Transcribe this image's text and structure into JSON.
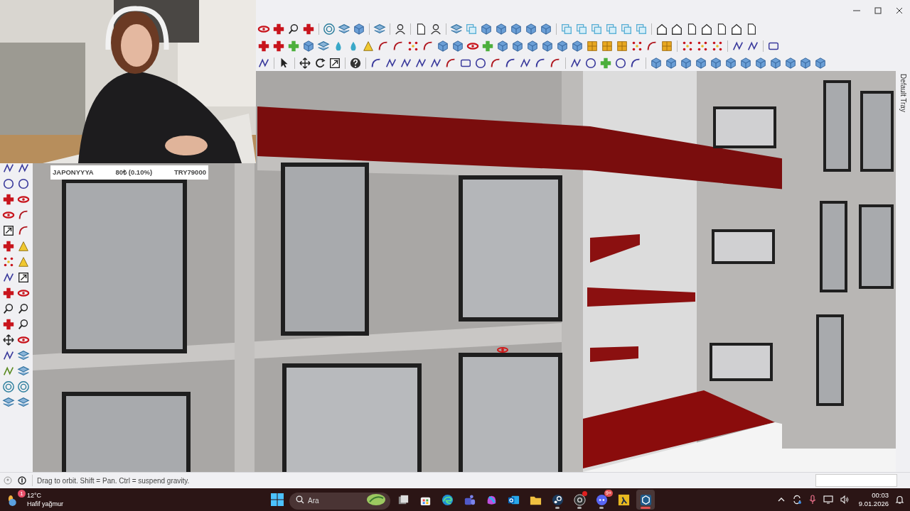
{
  "ticker": {
    "name": "JAPONYYYA",
    "amount": "80₺ (0.10%)",
    "goal": "TRY79000"
  },
  "side_tray": {
    "title": "Default Tray"
  },
  "status_bar": {
    "hint": "Drag to orbit. Shift = Pan. Ctrl = suspend gravity."
  },
  "taskbar": {
    "weather": {
      "temperature": "12°C",
      "condition": "Hafif yağmur",
      "badge": "1"
    },
    "search": {
      "placeholder": "Ara"
    },
    "apps": [
      {
        "kind": "task-view",
        "running": false,
        "selected": false
      },
      {
        "kind": "store",
        "running": false,
        "selected": false
      },
      {
        "kind": "browser",
        "running": false,
        "selected": false
      },
      {
        "kind": "teams",
        "running": false,
        "selected": false
      },
      {
        "kind": "copilot",
        "running": false,
        "selected": false
      },
      {
        "kind": "mail",
        "running": false,
        "selected": false
      },
      {
        "kind": "folder",
        "running": false,
        "selected": false
      },
      {
        "kind": "steam",
        "running": true,
        "selected": false
      },
      {
        "kind": "recorder",
        "running": true,
        "selected": false,
        "alert": true
      },
      {
        "kind": "chat",
        "running": true,
        "selected": false,
        "badge": "9+"
      },
      {
        "kind": "game",
        "running": false,
        "selected": false
      },
      {
        "kind": "modeler",
        "running": true,
        "selected": true
      }
    ],
    "clock": {
      "time": "00:03",
      "date": "9.01.2026"
    }
  }
}
